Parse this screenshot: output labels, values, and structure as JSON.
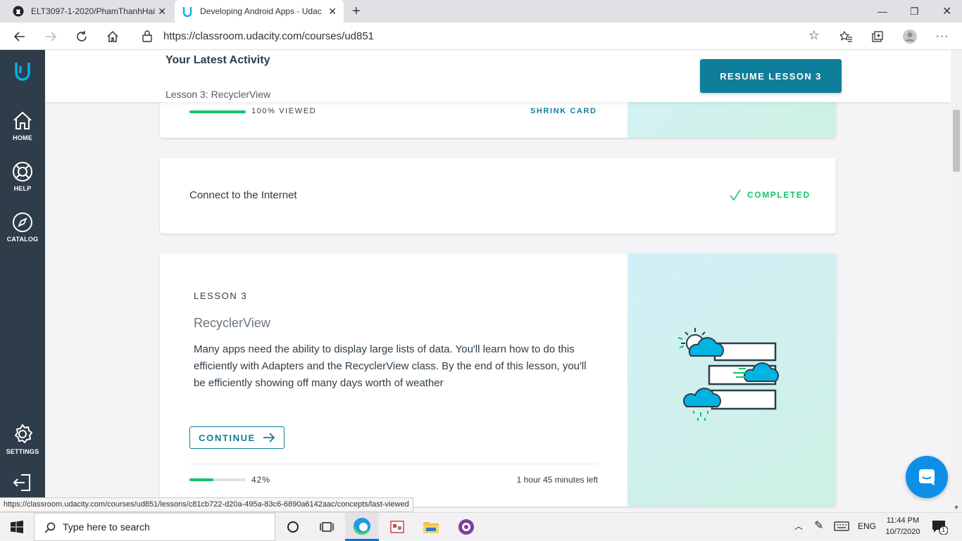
{
  "browser": {
    "tabs": [
      {
        "title": "ELT3097-1-2020/PhamThanhHai",
        "icon": "github-icon"
      },
      {
        "title": "Developing Android Apps - Udac",
        "icon": "udacity-icon"
      }
    ],
    "url": "https://classroom.udacity.com/courses/ud851"
  },
  "sidebar": {
    "items": [
      {
        "label": "HOME",
        "icon": "home-icon"
      },
      {
        "label": "HELP",
        "icon": "help-icon"
      },
      {
        "label": "CATALOG",
        "icon": "compass-icon"
      },
      {
        "label": "SETTINGS",
        "icon": "gear-icon"
      }
    ]
  },
  "activity": {
    "heading": "Your Latest Activity",
    "lesson": "Lesson 3: RecyclerView",
    "resume_label": "RESUME LESSON 3"
  },
  "card_prev": {
    "progress_percent": 100,
    "progress_label": "100% VIEWED",
    "shrink_label": "SHRINK CARD"
  },
  "card_concept": {
    "title": "Connect to the Internet",
    "status": "COMPLETED"
  },
  "card_lesson": {
    "eyebrow": "LESSON 3",
    "title": "RecyclerView",
    "description": "Many apps need the ability to display large lists of data. You'll learn how to do this efficiently with Adapters and the RecyclerView class. By the end of this lesson, you'll be efficiently showing off many days worth of weather",
    "continue_label": "CONTINUE",
    "progress_percent": 42,
    "progress_label": "42%",
    "time_left": "1 hour 45 minutes left"
  },
  "status_url": "https://classroom.udacity.com/courses/ud851/lessons/c81cb722-d20a-495a-83c6-6890a6142aac/concepts/last-viewed",
  "taskbar": {
    "search_placeholder": "Type here to search",
    "language": "ENG",
    "time": "11:44 PM",
    "date": "10/7/2020",
    "notification_count": "1"
  },
  "colors": {
    "udacity_blue": "#02b3e4",
    "udacity_green": "#15c26b",
    "button_dark": "#0f7e9b",
    "sidebar_bg": "#2e3d49"
  }
}
